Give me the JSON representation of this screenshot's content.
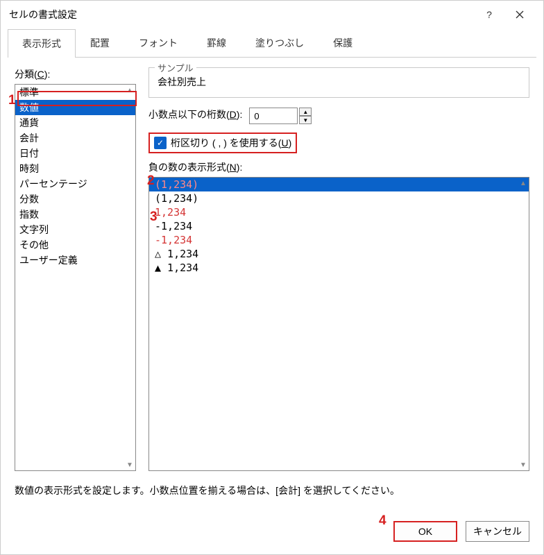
{
  "title": "セルの書式設定",
  "tabs": [
    "表示形式",
    "配置",
    "フォント",
    "罫線",
    "塗りつぶし",
    "保護"
  ],
  "activeTab": 0,
  "categoryLabel": "分類(C):",
  "categories": [
    "標準",
    "数値",
    "通貨",
    "会計",
    "日付",
    "時刻",
    "パーセンテージ",
    "分数",
    "指数",
    "文字列",
    "その他",
    "ユーザー定義"
  ],
  "categorySelected": 1,
  "sample": {
    "legend": "サンプル",
    "value": "会社別売上"
  },
  "decimals": {
    "label": "小数点以下の桁数(D):",
    "value": "0"
  },
  "thousands": {
    "label": "桁区切り ( , ) を使用する(U)",
    "checked": true
  },
  "negLabel": "負の数の表示形式(N):",
  "negFormats": [
    {
      "text": "(1,234)",
      "red": true,
      "selected": true
    },
    {
      "text": "(1,234)",
      "red": false
    },
    {
      "text": "1,234",
      "red": true
    },
    {
      "text": "-1,234",
      "red": false
    },
    {
      "text": "-1,234",
      "red": true
    },
    {
      "text": "△ 1,234",
      "red": false
    },
    {
      "text": "▲ 1,234",
      "red": false
    }
  ],
  "desc": "数値の表示形式を設定します。小数点位置を揃える場合は、[会計] を選択してください。",
  "buttons": {
    "ok": "OK",
    "cancel": "キャンセル"
  },
  "annotations": {
    "n1": "1",
    "n2": "2",
    "n3": "3",
    "n4": "4"
  }
}
